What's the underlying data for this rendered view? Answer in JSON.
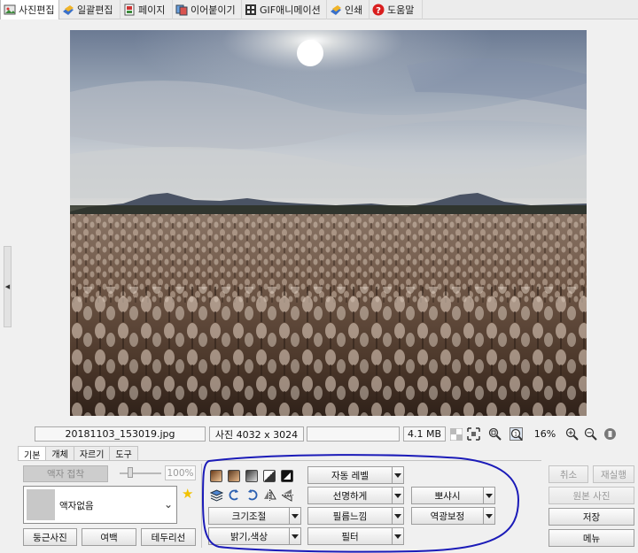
{
  "top_tabs": [
    {
      "label": "사진편집",
      "icon": "photo-edit-icon",
      "active": true
    },
    {
      "label": "일괄편집",
      "icon": "batch-edit-icon",
      "active": false
    },
    {
      "label": "페이지",
      "icon": "page-icon",
      "active": false
    },
    {
      "label": "이어붙이기",
      "icon": "stitch-icon",
      "active": false
    },
    {
      "label": "GIF애니메이션",
      "icon": "gif-icon",
      "active": false
    },
    {
      "label": "인쇄",
      "icon": "print-icon",
      "active": false
    },
    {
      "label": "도움말",
      "icon": "help-icon",
      "active": false
    }
  ],
  "status": {
    "filename": "20181103_153019.jpg",
    "dimensions": "사진 4032 x 3024",
    "filesize": "4.1 MB",
    "zoom": "16%"
  },
  "bottom_tabs": [
    "기본",
    "개체",
    "자르기",
    "도구"
  ],
  "basic_panel": {
    "frame_shrink_label": "액자 접착",
    "opacity_value": "100%",
    "frame_select_value": "액자없음",
    "round_photo_label": "둥근사진",
    "margin_label": "여백",
    "border_label": "테두리선"
  },
  "adjust_buttons": {
    "resize": "크기조절",
    "brightness": "밝기,색상",
    "auto_level": "자동 레벨",
    "sharpen": "선명하게",
    "film": "필름느낌",
    "filter": "필터",
    "soften": "뽀샤시",
    "backlight": "역광보정"
  },
  "side_buttons": {
    "undo": "취소",
    "redo": "재실행",
    "original": "원본 사진",
    "save": "저장",
    "menu": "메뉴"
  },
  "colors": {
    "highlight_stroke": "#1b1bb8",
    "tab_active_bg": "#ffffff",
    "star": "#f2c200"
  }
}
